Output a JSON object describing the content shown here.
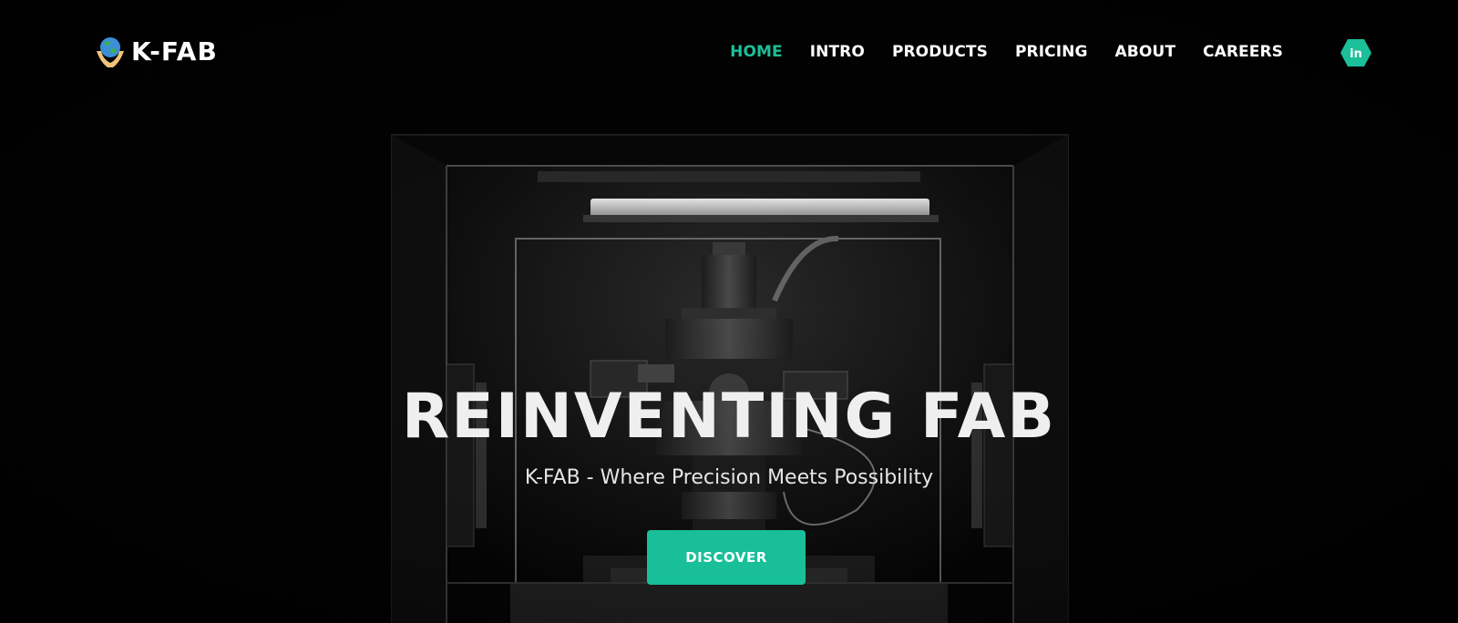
{
  "brand": {
    "name": "K-FAB",
    "logo_icon": "globe-in-hands-icon"
  },
  "nav": {
    "items": [
      {
        "label": "HOME",
        "active": true
      },
      {
        "label": "INTRO",
        "active": false
      },
      {
        "label": "PRODUCTS",
        "active": false
      },
      {
        "label": "PRICING",
        "active": false
      },
      {
        "label": "ABOUT",
        "active": false
      },
      {
        "label": "CAREERS",
        "active": false
      }
    ],
    "social_icon": "linkedin-icon",
    "social_label": "in"
  },
  "hero": {
    "title": "REINVENTING FAB",
    "subtitle": "K-FAB - Where Precision Meets Possibility",
    "cta_label": "DISCOVER",
    "background_image": "fabrication-machine-in-glass-enclosure"
  },
  "colors": {
    "accent": "#1bbf9a",
    "background": "#000000",
    "text": "#ffffff"
  }
}
